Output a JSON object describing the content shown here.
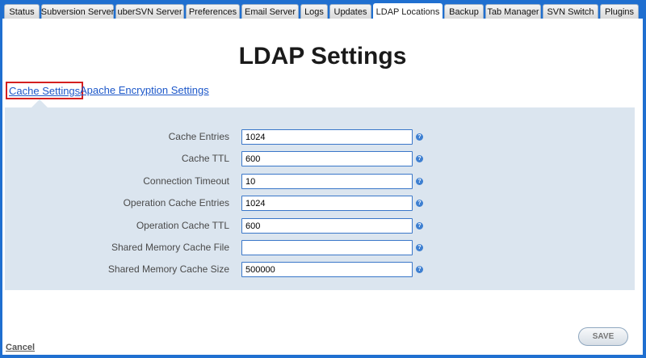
{
  "tabs": [
    {
      "label": "Status"
    },
    {
      "label": "Subversion Server"
    },
    {
      "label": "uberSVN Server"
    },
    {
      "label": "Preferences"
    },
    {
      "label": "Email Server"
    },
    {
      "label": "Logs"
    },
    {
      "label": "Updates"
    },
    {
      "label": "LDAP Locations",
      "active": true
    },
    {
      "label": "Backup"
    },
    {
      "label": "Tab Manager"
    },
    {
      "label": "SVN Switch"
    },
    {
      "label": "Plugins"
    }
  ],
  "page": {
    "title": "LDAP Settings"
  },
  "subnav": {
    "cache_settings": "Cache Settings",
    "apache_encryption": "Apache Encryption Settings"
  },
  "form": {
    "fields": [
      {
        "label": "Cache Entries",
        "value": "1024"
      },
      {
        "label": "Cache TTL",
        "value": "600"
      },
      {
        "label": "Connection Timeout",
        "value": "10"
      },
      {
        "label": "Operation Cache Entries",
        "value": "1024"
      },
      {
        "label": "Operation Cache TTL",
        "value": "600"
      },
      {
        "label": "Shared Memory Cache File",
        "value": ""
      },
      {
        "label": "Shared Memory Cache Size",
        "value": "500000"
      }
    ],
    "help_glyph": "?"
  },
  "footer": {
    "cancel_label": "Cancel",
    "save_label": "SAVE"
  },
  "colors": {
    "frame_blue": "#1f6fd0",
    "link_blue": "#1c57c9",
    "highlight_red": "#d42020",
    "form_background": "#dbe5ef"
  }
}
